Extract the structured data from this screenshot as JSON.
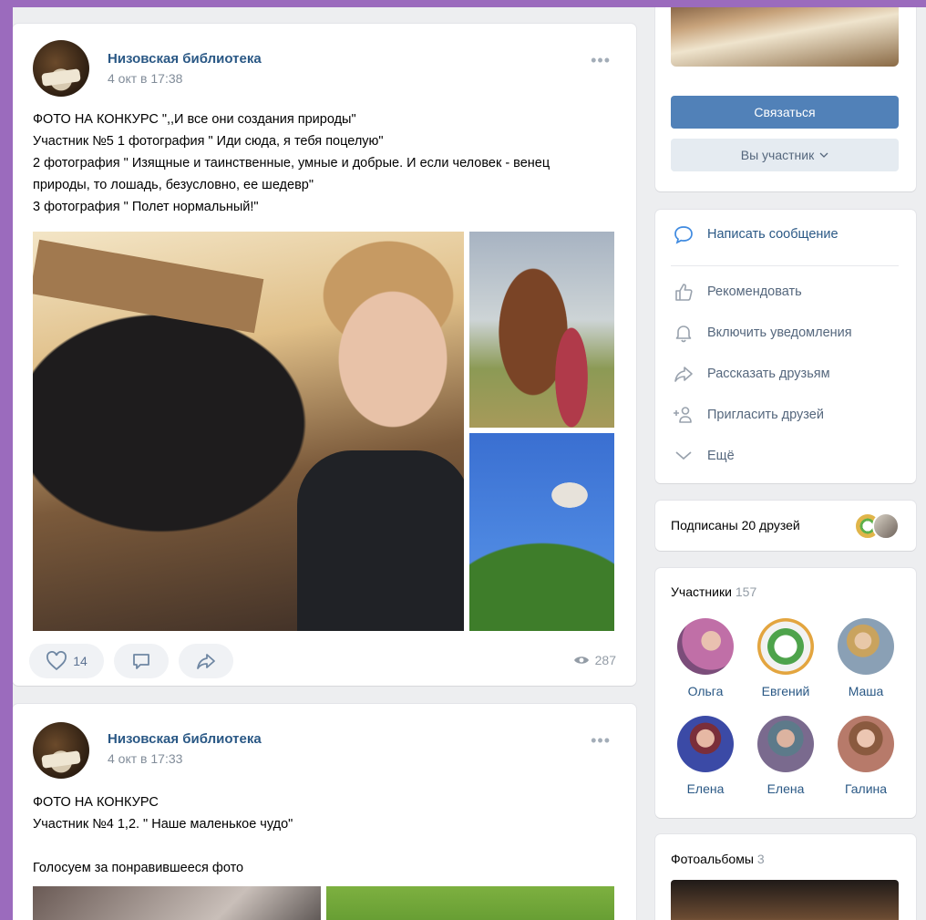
{
  "post1": {
    "author": "Низовская библиотека",
    "date": "4 окт в 17:38",
    "more": "•••",
    "lines": [
      "ФОТО НА КОНКУРС \",,И все они создания природы\"",
      "Участник №5 1 фотография \" Иди сюда, я тебя поцелую\"",
      "2 фотография \" Изящные и таинственные, умные и добрые. И если человек - венец",
      "природы, то лошадь, безусловно, ее шедевр\"",
      "3 фотография \" Полет нормальный!\""
    ],
    "likes": "14",
    "views": "287"
  },
  "post2": {
    "author": "Низовская библиотека",
    "date": "4 окт в 17:33",
    "more": "•••",
    "lines": [
      "ФОТО НА КОНКУРС",
      "Участник №4 1,2. \" Наше маленькое чудо\"",
      "",
      "Голосуем за понравившееся фото"
    ]
  },
  "sidebar": {
    "contact_button": "Связаться",
    "member_button": "Вы участник",
    "menu": [
      {
        "label": "Написать сообщение",
        "icon": "message-icon"
      },
      {
        "label": "Рекомендовать",
        "icon": "thumbs-up-icon"
      },
      {
        "label": "Включить уведомления",
        "icon": "bell-icon"
      },
      {
        "label": "Рассказать друзьям",
        "icon": "share-icon"
      },
      {
        "label": "Пригласить друзей",
        "icon": "add-user-icon"
      },
      {
        "label": "Ещё",
        "icon": "chevron-down-icon"
      }
    ],
    "friends_subscribed": "Подписаны 20 друзей",
    "members_title": "Участники",
    "members_count": "157",
    "members": [
      {
        "name": "Ольга",
        "color": "#c06fa7"
      },
      {
        "name": "Евгений",
        "color": "#4ea34b"
      },
      {
        "name": "Маша",
        "color": "#8aa0b5"
      },
      {
        "name": "Елена",
        "color": "#3b4aa6"
      },
      {
        "name": "Елена",
        "color": "#7a6a8e"
      },
      {
        "name": "Галина",
        "color": "#b77a6a"
      }
    ],
    "albums_title": "Фотоальбомы",
    "albums_count": "3"
  },
  "colors": {
    "accent": "#5181b8",
    "link": "#2a5885",
    "muted": "#818c99"
  }
}
